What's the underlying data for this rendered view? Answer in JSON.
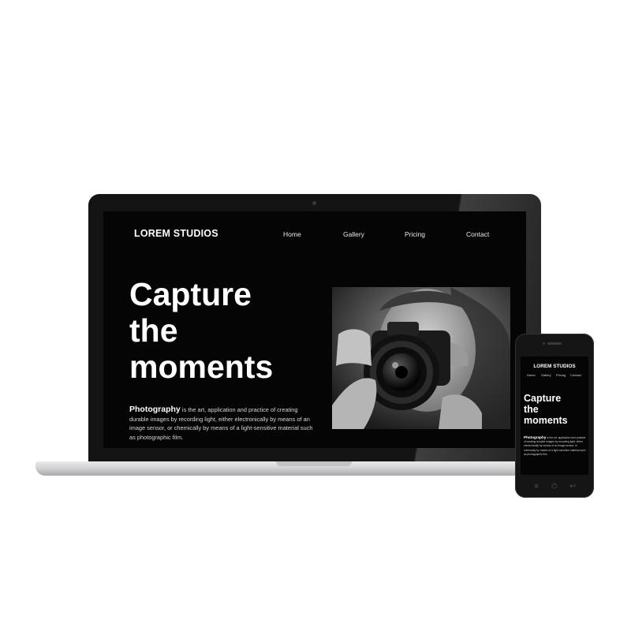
{
  "site": {
    "logo": "LOREM STUDIOS",
    "nav": [
      "Home",
      "Gallery",
      "Pricing",
      "Contact"
    ],
    "headline_lines": [
      "Capture",
      "the",
      "moments"
    ],
    "body_lead": "Photography",
    "body_text": " is the art, application and practice of creating durable images by recording light, either electronically by means of an image sensor, or chemically by means of a light-sensitive material such as photographic film."
  },
  "hero_image": {
    "subject": "person-holding-camera-photo"
  },
  "phone_buttons": [
    "menu-icon",
    "power-icon",
    "back-icon"
  ],
  "colors": {
    "screen_bg": "#050505",
    "text": "#ffffff",
    "device_frame": "#141414",
    "laptop_base": "#d4d4d6"
  }
}
